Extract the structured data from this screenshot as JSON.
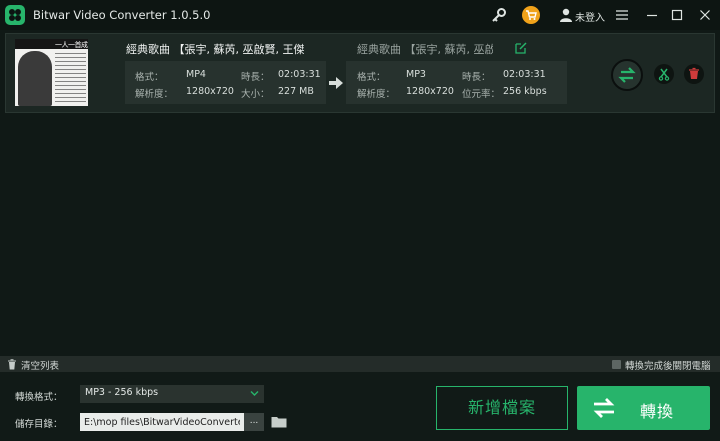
{
  "app": {
    "title": "Bitwar Video Converter  1.0.5.0",
    "login": "未登入"
  },
  "file": {
    "name": "經典歌曲 【張宇, 蘇芮, 巫啟賢, 王傑, ...",
    "output_name": "經典歌曲 【張宇, 蘇芮, 巫啟...",
    "thumbnail_title": "一人一首成名曲",
    "source": {
      "format_label": "格式：",
      "format": "MP4",
      "duration_label": "時長：",
      "duration": "02:03:31",
      "resolution_label": "解析度：",
      "resolution": "1280x720",
      "size_label": "大小：",
      "size": "227 MB"
    },
    "target": {
      "format_label": "格式：",
      "format": "MP3",
      "duration_label": "時長：",
      "duration": "02:03:31",
      "resolution_label": "解析度：",
      "resolution": "1280x720",
      "bitrate_label": "位元率：",
      "bitrate": "256 kbps"
    }
  },
  "strip": {
    "clear_list": "清空列表",
    "shutdown": "轉換完成後關閉電腦"
  },
  "bottom": {
    "format_label": "轉換格式：",
    "format_value": "MP3 - 256 kbps",
    "save_label": "儲存目錄：",
    "save_path": "E:\\mop files\\BitwarVideoConverter\\",
    "browse_label": "...",
    "add_button": "新增檔案",
    "convert_button": "轉換"
  },
  "colors": {
    "accent": "#27b46b",
    "background": "#101916",
    "cart": "#f0a21a",
    "delete": "#d03b3b"
  }
}
